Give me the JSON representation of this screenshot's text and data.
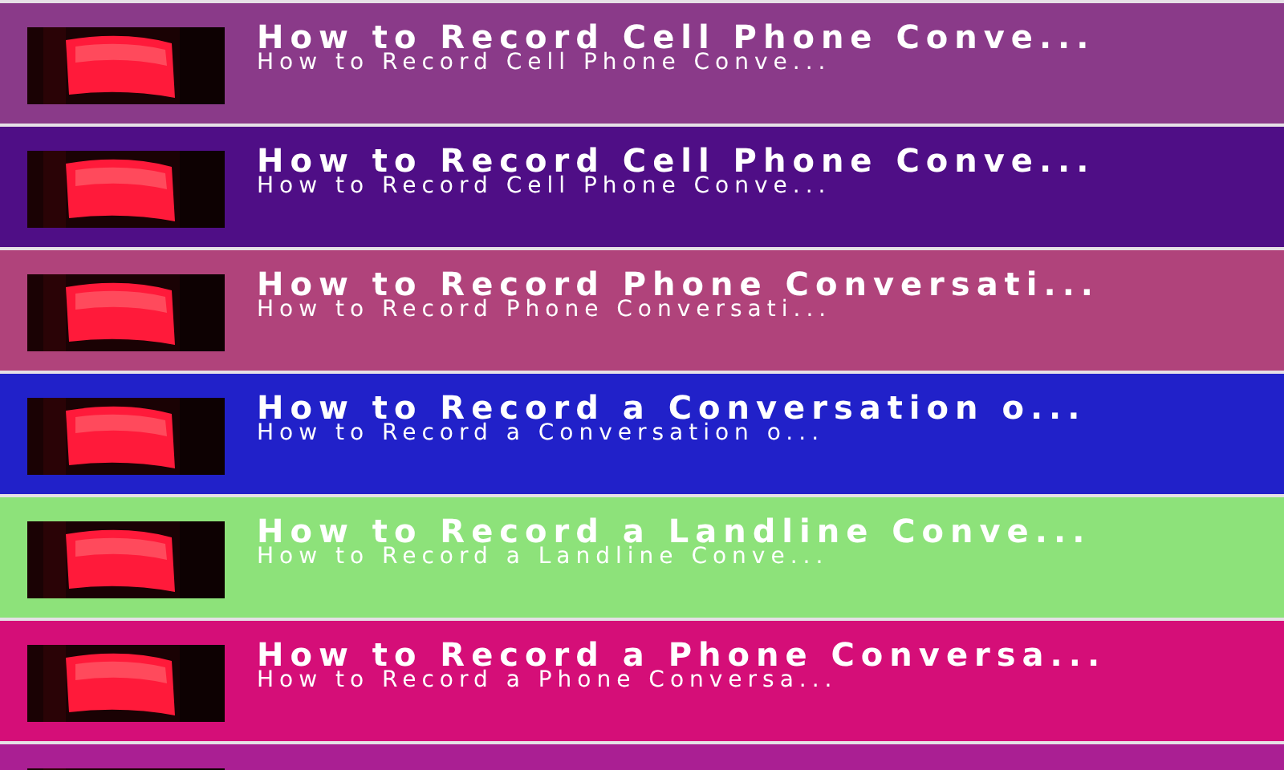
{
  "items": [
    {
      "title": "How to Record Cell Phone Conve...",
      "subtitle": "How to Record Cell Phone Conve...",
      "color": "#8a3a89"
    },
    {
      "title": "How to Record Cell Phone Conve...",
      "subtitle": "How to Record Cell Phone Conve...",
      "color": "#4f0e86"
    },
    {
      "title": "How to Record Phone Conversati...",
      "subtitle": "How to Record Phone Conversati...",
      "color": "#b0437b"
    },
    {
      "title": "How to Record a Conversation o...",
      "subtitle": "How to Record a Conversation o...",
      "color": "#2121c9"
    },
    {
      "title": "How to Record a Landline Conve...",
      "subtitle": "How to Record a Landline Conve...",
      "color": "#8de27a"
    },
    {
      "title": "How to Record a Phone Conversa...",
      "subtitle": "How to Record a Phone Conversa...",
      "color": "#d50e78"
    },
    {
      "color": "#aa1f93"
    }
  ]
}
